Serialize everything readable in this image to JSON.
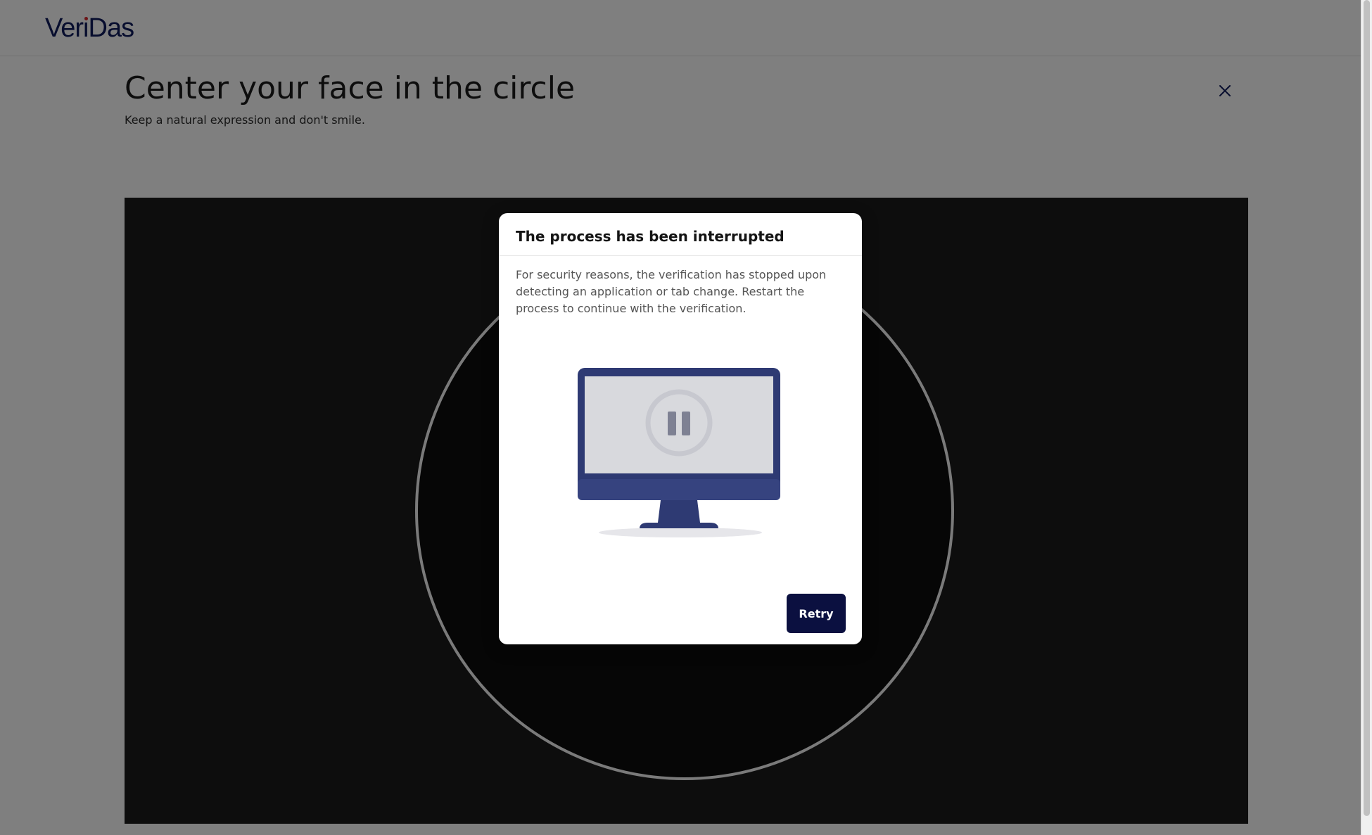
{
  "header": {
    "logo": {
      "part1": "Ver",
      "part2": "i",
      "part3": "Das"
    }
  },
  "main": {
    "title": "Center your face in the circle",
    "subtitle": "Keep a natural expression and don't smile."
  },
  "modal": {
    "title": "The process has been interrupted",
    "body": "For security reasons, the verification has stopped upon detecting an application or tab change. Restart the process to continue with the verification.",
    "retry_label": "Retry"
  },
  "icons": {
    "close": "close-icon",
    "illustration": "paused-monitor-icon"
  },
  "colors": {
    "brand_navy": "#0f1b5c",
    "brand_red_dot": "#d9282f",
    "button_bg": "#0b1040",
    "monitor_frame": "#2e3a73",
    "monitor_screen": "#d8d9dd",
    "pause_symbol": "#7e8193",
    "camera_bg": "#1b1b1b",
    "overlay": "rgba(0,0,0,0.5)"
  }
}
